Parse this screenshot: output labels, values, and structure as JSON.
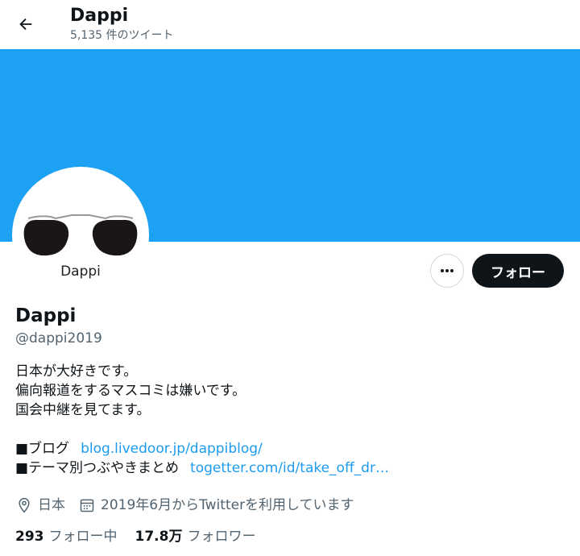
{
  "header": {
    "title": "Dappi",
    "tweet_count": "5,135 件のツイート"
  },
  "profile": {
    "avatar_text": "Dappi",
    "name": "Dappi",
    "handle": "@dappi2019",
    "follow_label": "フォロー",
    "bio": {
      "line1": "日本が大好きです。",
      "line2": "偏向報道をするマスコミは嫌いです。",
      "line3": "国会中継を見てます。",
      "link1_label": "■ブログ",
      "link1_url": "blog.livedoor.jp/dappiblog/",
      "link2_label": "■テーマ別つぶやきまとめ",
      "link2_url": "togetter.com/id/take_off_dr…"
    },
    "location": "日本",
    "joined": "2019年6月からTwitterを利用しています",
    "following_count": "293",
    "following_label": "フォロー中",
    "followers_count": "17.8万",
    "followers_label": "フォロワー"
  },
  "colors": {
    "banner": "#1da1f2",
    "link": "#1d9bf0",
    "follow_button": "#0f1419"
  },
  "icons": [
    "back-arrow-icon",
    "more-icon",
    "location-icon",
    "calendar-icon"
  ]
}
